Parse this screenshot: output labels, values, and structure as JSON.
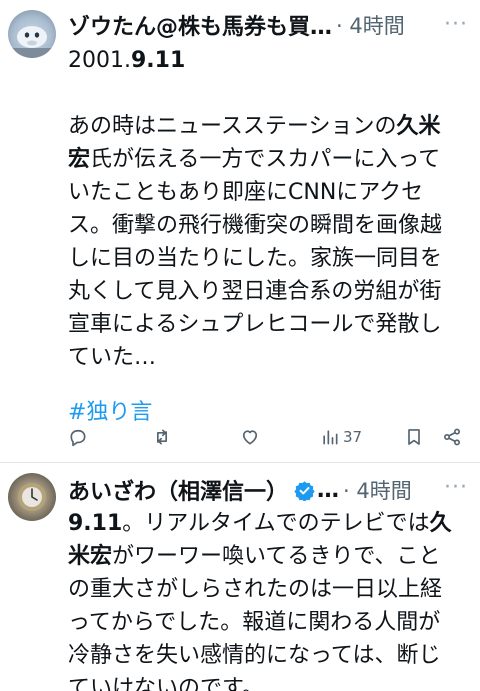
{
  "tweets": [
    {
      "name": "ゾウたん@株も馬券も買…",
      "time": "· 4時間",
      "more": "···",
      "lines": [
        [
          {
            "t": "2001."
          },
          {
            "t": "9.11",
            "b": true
          }
        ],
        [],
        [
          {
            "t": "あの時はニュースステーションの"
          },
          {
            "t": "久米",
            "b": true
          }
        ],
        [
          {
            "t": "宏",
            "b": true
          },
          {
            "t": "氏が伝える一方でスカパーに入って"
          }
        ],
        [
          {
            "t": "いたこともあり即座にCNNにアクセ"
          }
        ],
        [
          {
            "t": "ス。衝撃の飛行機衝突の瞬間を画像越"
          }
        ],
        [
          {
            "t": "しに目の当たりにした。家族一同目を"
          }
        ],
        [
          {
            "t": "丸くして見入り翌日連合系の労組が街"
          }
        ],
        [
          {
            "t": "宣車によるシュプレヒコールで発散し"
          }
        ],
        [
          {
            "t": "ていた…"
          }
        ]
      ],
      "hashtag": "#独り言",
      "views": "37"
    },
    {
      "name": "あいざわ（相澤信一）",
      "ellipsis": "…",
      "time": "· 4時間",
      "more": "···",
      "lines": [
        [
          {
            "t": "9.11",
            "b": true
          },
          {
            "t": "。リアルタイムでのテレビでは"
          },
          {
            "t": "久",
            "b": true
          }
        ],
        [
          {
            "t": "米宏",
            "b": true
          },
          {
            "t": "がワーワー喚いてるきりで、こと"
          }
        ],
        [
          {
            "t": "の重大さがしらされたのは一日以上経"
          }
        ],
        [
          {
            "t": "ってからでした。報道に関わる人間が"
          }
        ],
        [
          {
            "t": "冷静さを失い感情的になっては、断じ"
          }
        ],
        [
          {
            "t": "ていけないのです。"
          }
        ]
      ]
    }
  ],
  "icons": {
    "reply": "reply-icon",
    "retweet": "retweet-icon",
    "like": "heart-icon",
    "views": "views-icon",
    "bookmark": "bookmark-icon",
    "share": "share-icon",
    "verified": "verified-badge-icon"
  },
  "colors": {
    "hashtag": "#1d9bf0",
    "verified": "#1d9bf0",
    "meta": "#536471"
  }
}
